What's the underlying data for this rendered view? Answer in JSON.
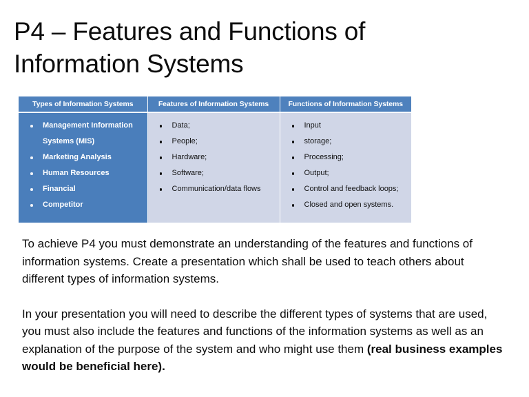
{
  "slide": {
    "title": "P4 – Features and Functions of\nInformation Systems",
    "background_color": "#ffffff",
    "accent_color": "#4e81bd",
    "cell_tint_color": "#d0d6e7"
  },
  "table": {
    "headers": [
      "Types of Information Systems",
      "Features of Information Systems",
      "Functions of Information Systems"
    ],
    "columns": {
      "types": [
        "Management Information\nSystems (MIS)",
        "Marketing Analysis",
        "Human Resources",
        "Financial",
        "Competitor"
      ],
      "features": [
        "Data;",
        "People;",
        "Hardware;",
        "Software;",
        "Communication/data flows"
      ],
      "functions": [
        "Input",
        "storage;",
        "Processing;",
        "Output;",
        "Control and feedback loops;",
        "Closed and open systems."
      ]
    }
  },
  "body": {
    "paragraph1": "To achieve P4 you must demonstrate an understanding of the features and functions of information systems. Create a presentation which shall be used to teach others about different types of information systems.",
    "paragraph2_normal": "In your presentation you will need to describe the different types of systems that are used, you must also include the features and functions of the information systems as well as an explanation of the purpose of the system and who might use them ",
    "paragraph2_bold": "(real business examples would be beneficial here)."
  }
}
